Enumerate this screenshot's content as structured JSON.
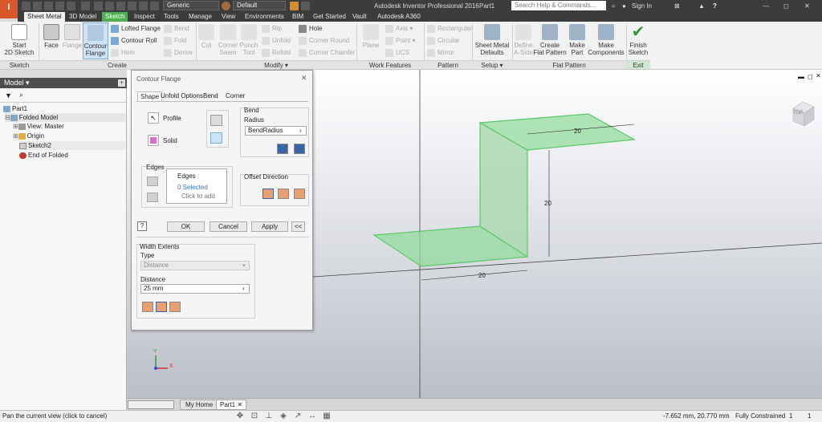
{
  "app": {
    "title": "Autodesk Inventor Professional 2016",
    "doc": "Part1",
    "logo_text": "I",
    "appearance": "Generic",
    "style": "Default",
    "search_placeholder": "Search Help & Commands...",
    "sign_in": "Sign In",
    "help": "?"
  },
  "menu_tabs": [
    "Sheet Metal",
    "3D Model",
    "Sketch",
    "Inspect",
    "Tools",
    "Manage",
    "View",
    "Environments",
    "BIM",
    "Get Started",
    "Vault",
    "Autodesk A360"
  ],
  "ribbon": {
    "sketch": {
      "start_line1": "Start",
      "start_line2": "2D Sketch",
      "group": "Sketch"
    },
    "create": {
      "face": "Face",
      "flange": "Flange",
      "contour_line1": "Contour",
      "contour_line2": "Flange",
      "lofted": "Lofted Flange",
      "roll": "Contour Roll",
      "hem": "Hem",
      "bend": "Bend",
      "fold": "Fold",
      "derive": "Derive",
      "group": "Create"
    },
    "modify": {
      "cut": "Cut",
      "corner_seam_l1": "Corner",
      "corner_seam_l2": "Seam",
      "punch_l1": "Punch",
      "punch_l2": "Tool",
      "rip": "Rip",
      "unfold": "Unfold",
      "refold": "Refold",
      "hole": "Hole",
      "corner_round": "Corner Round",
      "corner_chamfer": "Corner Chamfer",
      "group": "Modify ▾"
    },
    "work": {
      "plane": "Plane",
      "axis": "Axis ▾",
      "point": "Point ▾",
      "ucs": "UCS",
      "group": "Work Features"
    },
    "pattern": {
      "rect": "Rectangular",
      "circ": "Circular",
      "mirror": "Mirror",
      "group": "Pattern"
    },
    "setup": {
      "l1": "Sheet Metal",
      "l2": "Defaults",
      "group": "Setup ▾"
    },
    "flat": {
      "define_l1": "Define",
      "define_l2": "A-Side",
      "create_l1": "Create",
      "create_l2": "Flat Pattern",
      "part_l1": "Make",
      "part_l2": "Part",
      "comp_l1": "Make",
      "comp_l2": "Components",
      "group": "Flat Pattern"
    },
    "exit": {
      "l1": "Finish",
      "l2": "Sketch",
      "group": "Exit"
    }
  },
  "browser": {
    "header": "Model ▾",
    "items": [
      "Part1",
      "Folded Model",
      "View: Master",
      "Origin",
      "Sketch2",
      "End of Folded"
    ]
  },
  "dialog": {
    "title": "Contour Flange",
    "tabs": [
      "Shape",
      "Unfold Options",
      "Bend",
      "Corner"
    ],
    "profile": "Profile",
    "solid": "Solid",
    "bend_label": "Bend",
    "radius_label": "Radius",
    "radius_value": "BendRadius",
    "edges_group": "Edges",
    "edges_title": "Edges",
    "edges_selected": "0 Selected",
    "edges_hint": "Click to add",
    "offset_label": "Offset Direction",
    "ok": "OK",
    "cancel": "Cancel",
    "apply": "Apply",
    "more": "<<",
    "help": "?",
    "width_extents": "Width Extents",
    "type_label": "Type",
    "type_value": "Distance",
    "distance_label": "Distance",
    "distance_value": "25 mm"
  },
  "viewport": {
    "dim_top": "20",
    "dim_vert": "20",
    "dim_bottom": "20",
    "viewcube": "TOP",
    "axis_x": "X",
    "axis_y": "Y"
  },
  "doctabs": {
    "home": "My Home",
    "part": "Part1"
  },
  "status": {
    "hint": "Pan the current view (click to cancel)",
    "coords": "-7.652 mm, 20.770 mm",
    "constraint": "Fully Constrained",
    "num1": "1",
    "num2": "1"
  },
  "colors": {
    "accent": "#4caf50",
    "flange": "#7fd98a",
    "logo": "#d9572b"
  }
}
